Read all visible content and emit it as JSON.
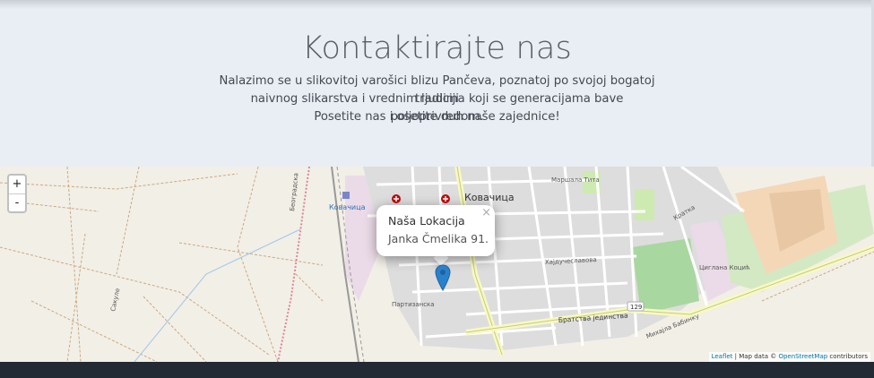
{
  "hero": {
    "title": "Kontaktirajte nas",
    "description_lines": [
      "Nalazimo se u slikovitoj varošici blizu Pančeva, poznatoj po svojoj bogatoj tradiciji",
      "naivnog slikarstva i vrednim ljudima koji se generacijama bave poljoprivredom.",
      "Posetite nas i osetite duh naše zajednice!"
    ]
  },
  "map": {
    "zoom_in": "+",
    "zoom_out": "-",
    "popup": {
      "title": "Naša Lokacija",
      "address": "Janka Čmelika 91.",
      "close": "×"
    },
    "labels": {
      "town": "Ковачица",
      "station": "Ковачица",
      "street_beograd": "Београдска",
      "street_canal": "Сакуле",
      "street_bratstva": "Братства јединства",
      "road_number": "129",
      "cemetery": "Циглана Коцић",
      "street_partizanska": "Партизанска",
      "street_hajducka": "Хајдучеславова",
      "street_maxima": "Маршала Тита",
      "street_mixajla": "Михајла Бабинку",
      "street_kratka": "Кратка"
    },
    "attribution": {
      "leaflet": "Leaflet",
      "separator": " | Map data © ",
      "osm": "OpenStreetMap",
      "suffix": " contributors"
    },
    "colors": {
      "marker": "#2a81cb",
      "land": "#f2efe6",
      "residential": "#dcdcdc",
      "park": "#cdebb0",
      "industrial": "#ebdbe8",
      "road_major": "#f7fabf",
      "rail": "#8c8c8c"
    }
  }
}
